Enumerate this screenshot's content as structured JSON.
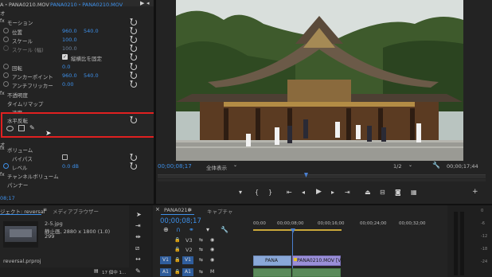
{
  "effect_controls": {
    "header_path": "A・PANA0210.MOV",
    "header_clip": "PANA0210・PANA0210.MOV",
    "section_video": "オ",
    "motion": "モーション",
    "position": {
      "label": "位置",
      "x": "960.0",
      "y": "540.0"
    },
    "scale": {
      "label": "スケール",
      "value": "100.0"
    },
    "scale_width": {
      "label": "スケール (幅)",
      "value": "100.0"
    },
    "uniform_scale": "縦横比を固定",
    "rotation": {
      "label": "回転",
      "value": "0.0"
    },
    "anchor": {
      "label": "アンカーポイント",
      "x": "960.0",
      "y": "540.0"
    },
    "antiflicker": {
      "label": "アンチフリッカー",
      "value": "0.00"
    },
    "opacity": "不透明度",
    "time_remap": "タイムリマップ",
    "speed_partial": "速度",
    "horizontal_flip": "水平反転",
    "volume_section": "ボリューム",
    "bypass": "バイパス",
    "level": {
      "label": "レベル",
      "value": "0.0 dB"
    },
    "channel_volume": "チャンネルボリューム",
    "panner": "パンナー",
    "time_fragment": "08;17",
    "audio_section_partial": "オ"
  },
  "program_monitor": {
    "timecode": "00;00;08;17",
    "fit": "全体表示",
    "resolution": "1/2",
    "duration": "00;00;17;44"
  },
  "project_panel": {
    "title": "ジェクト: reversal",
    "tab2": "メディアブラウザー",
    "file_name": "2-5.jpg",
    "file_type": "静止画, 2880 x 1800 (1.0)",
    "file_extra": "299",
    "project_file": "reversal.prproj",
    "count": "17 個中 1..."
  },
  "timeline": {
    "tab": "PANA0210",
    "tab2": "キャプチャ",
    "timecode": "00;00;08;17",
    "ruler": [
      "00;00",
      "00;00;08;00",
      "00;00;16;00",
      "00;00;24;00",
      "00;00;32;00"
    ],
    "tracks": [
      {
        "src": "",
        "name": "V3"
      },
      {
        "src": "",
        "name": "V2"
      },
      {
        "src": "V1",
        "name": "V1"
      },
      {
        "src": "A1",
        "name": "A1"
      }
    ],
    "clip_a": "PANA",
    "clip_b": "PANA0210.MOV [V]"
  },
  "colors": {
    "accent": "#3d8fe8",
    "highlight_box": "#e02020",
    "playhead": "#4a7fd0"
  }
}
